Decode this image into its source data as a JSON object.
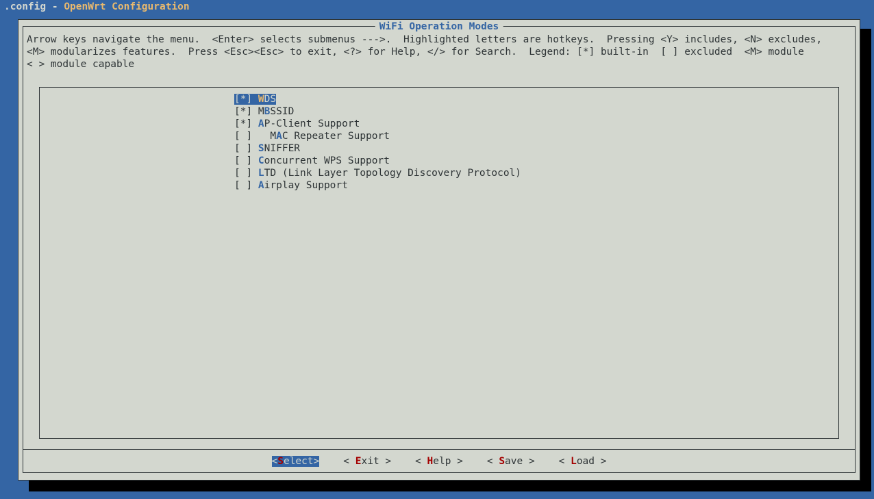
{
  "title_plain": ".config - ",
  "title_hl": "OpenWrt Configuration",
  "dialog_title": "WiFi Operation Modes",
  "help_text": "Arrow keys navigate the menu.  <Enter> selects submenus --->.  Highlighted letters are hotkeys.  Pressing <Y> includes, <N> excludes,\n<M> modularizes features.  Press <Esc><Esc> to exit, <?> for Help, </> for Search.  Legend: [*] built-in  [ ] excluded  <M> module \n< > module capable",
  "menu": [
    {
      "state": "[*]",
      "pre": "",
      "hot": "W",
      "post": "DS",
      "selected": true
    },
    {
      "state": "[*]",
      "pre": "M",
      "hot": "B",
      "post": "SSID",
      "selected": false
    },
    {
      "state": "[*]",
      "pre": "",
      "hot": "A",
      "post": "P-Client Support",
      "selected": false
    },
    {
      "state": "[ ]",
      "pre": "  M",
      "hot": "A",
      "post": "C Repeater Support",
      "selected": false
    },
    {
      "state": "[ ]",
      "pre": "",
      "hot": "S",
      "post": "NIFFER",
      "selected": false
    },
    {
      "state": "[ ]",
      "pre": "",
      "hot": "C",
      "post": "oncurrent WPS Support",
      "selected": false
    },
    {
      "state": "[ ]",
      "pre": "",
      "hot": "L",
      "post": "TD (Link Layer Topology Discovery Protocol)",
      "selected": false
    },
    {
      "state": "[ ]",
      "pre": "",
      "hot": "A",
      "post": "irplay Support",
      "selected": false
    }
  ],
  "buttons": {
    "select": {
      "label_pre": "<",
      "hk": "S",
      "label_post": "elect>",
      "selected": true
    },
    "exit": {
      "label_pre": "< ",
      "hk": "E",
      "label_post": "xit >"
    },
    "help": {
      "label_pre": "< ",
      "hk": "H",
      "label_post": "elp >"
    },
    "save": {
      "label_pre": "< ",
      "hk": "S",
      "label_post": "ave >"
    },
    "load": {
      "label_pre": "< ",
      "hk": "L",
      "label_post": "oad >"
    }
  }
}
